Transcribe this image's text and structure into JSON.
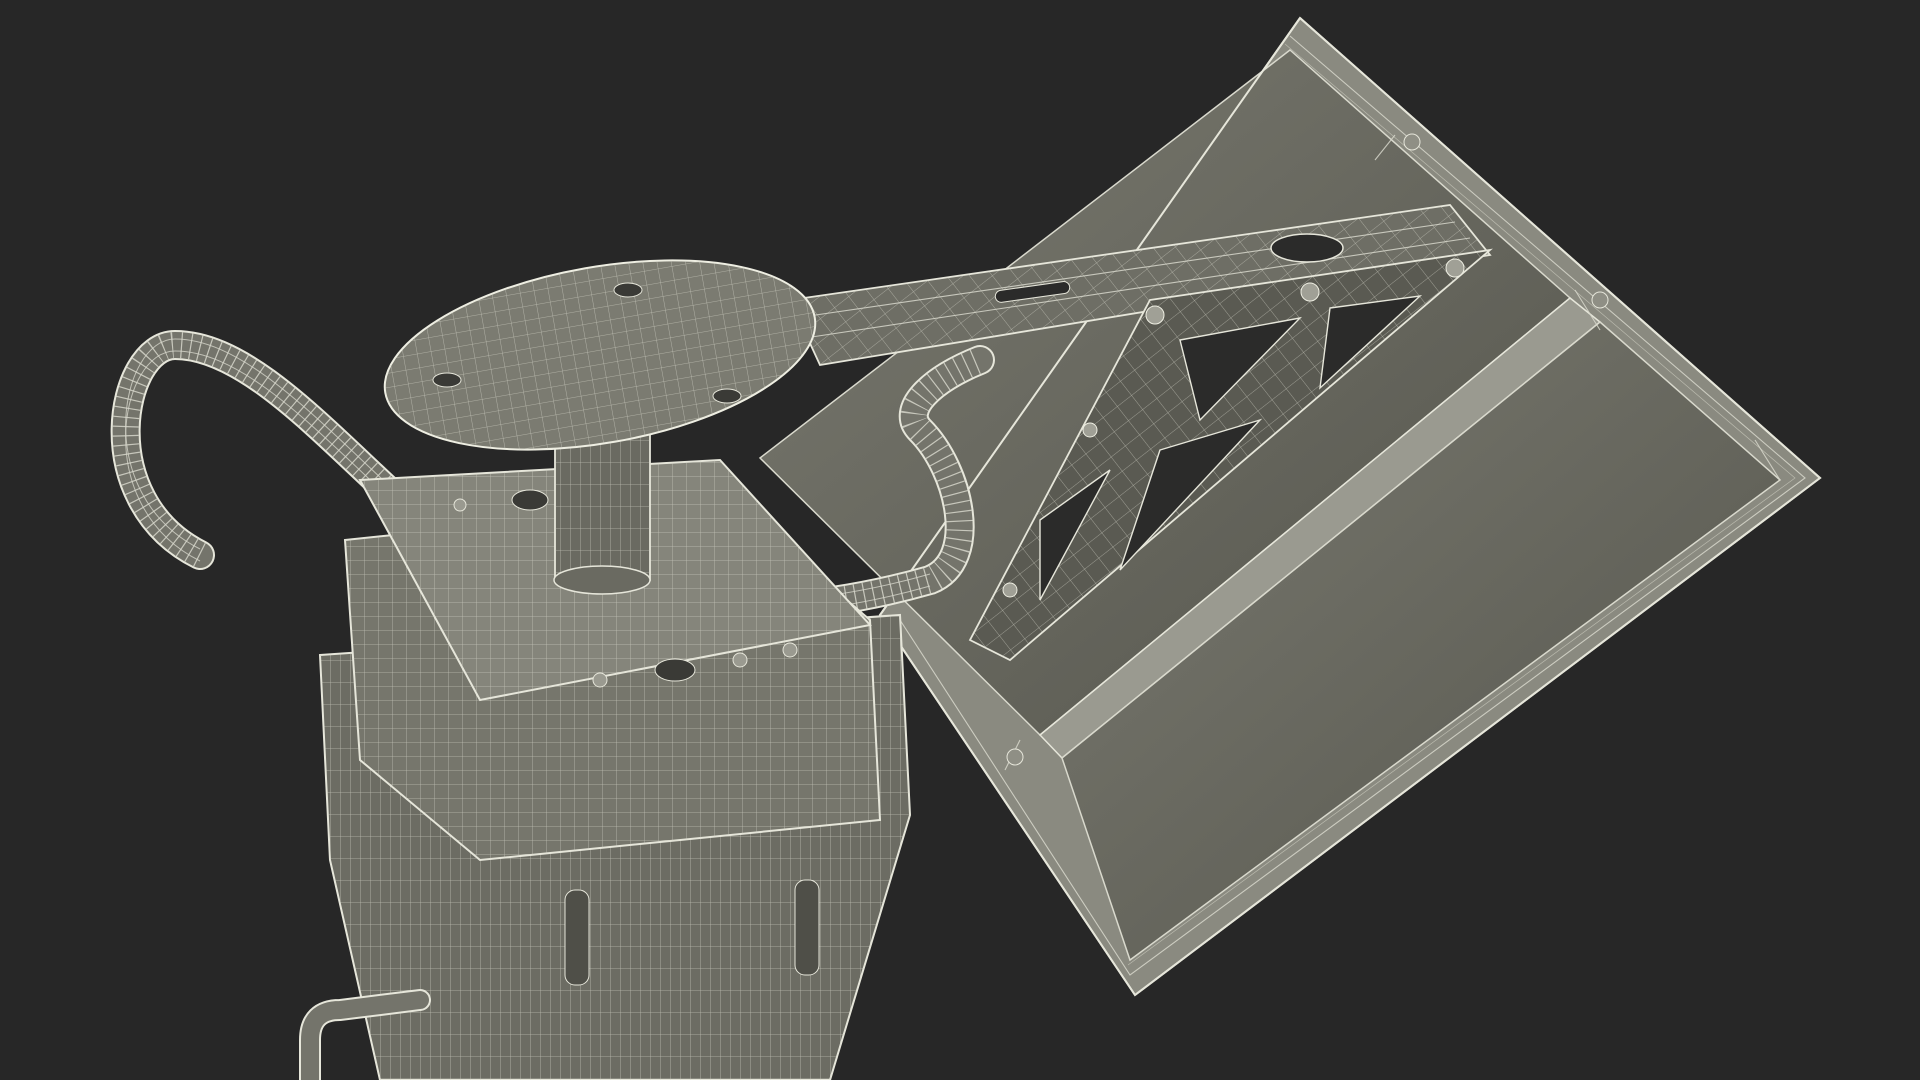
{
  "scene": {
    "background_color": "#272727",
    "mesh_fill_color": "#6c6c63",
    "mesh_dark_fill_color": "#4f4f48",
    "wire_color": "#d8d8cc",
    "objects": [
      {
        "name": "stand-base-body",
        "label": ""
      },
      {
        "name": "seat-disc",
        "label": ""
      },
      {
        "name": "tube-handle",
        "label": ""
      },
      {
        "name": "support-arm",
        "label": ""
      },
      {
        "name": "truss-bracket",
        "label": ""
      },
      {
        "name": "solar-panel-frame",
        "label": ""
      }
    ]
  }
}
